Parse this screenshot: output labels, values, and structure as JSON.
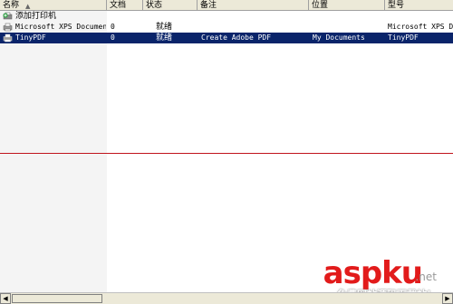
{
  "columns": [
    "名称",
    "文档",
    "状态",
    "备注",
    "位置",
    "型号"
  ],
  "rows": [
    {
      "name": "添加打印机",
      "icon": "add-printer-icon"
    },
    {
      "name": "Microsoft XPS Documen...",
      "docs": "0",
      "status": "就绪",
      "comment": "",
      "location": "",
      "model": "Microsoft XPS D..."
    },
    {
      "name": "TinyPDF",
      "docs": "0",
      "status": "就绪",
      "comment": "Create Adobe PDF",
      "location": "My Documents",
      "model": "TinyPDF",
      "selected": true
    }
  ],
  "watermark": {
    "logo": "aspku",
    "suffix": ".net",
    "subtitle": "免费网站源码下载站!"
  },
  "colors": {
    "selection": "#0a246a",
    "header_bg": "#ece9d8",
    "divider": "#c0141c",
    "watermark_red": "#e21b1b"
  }
}
